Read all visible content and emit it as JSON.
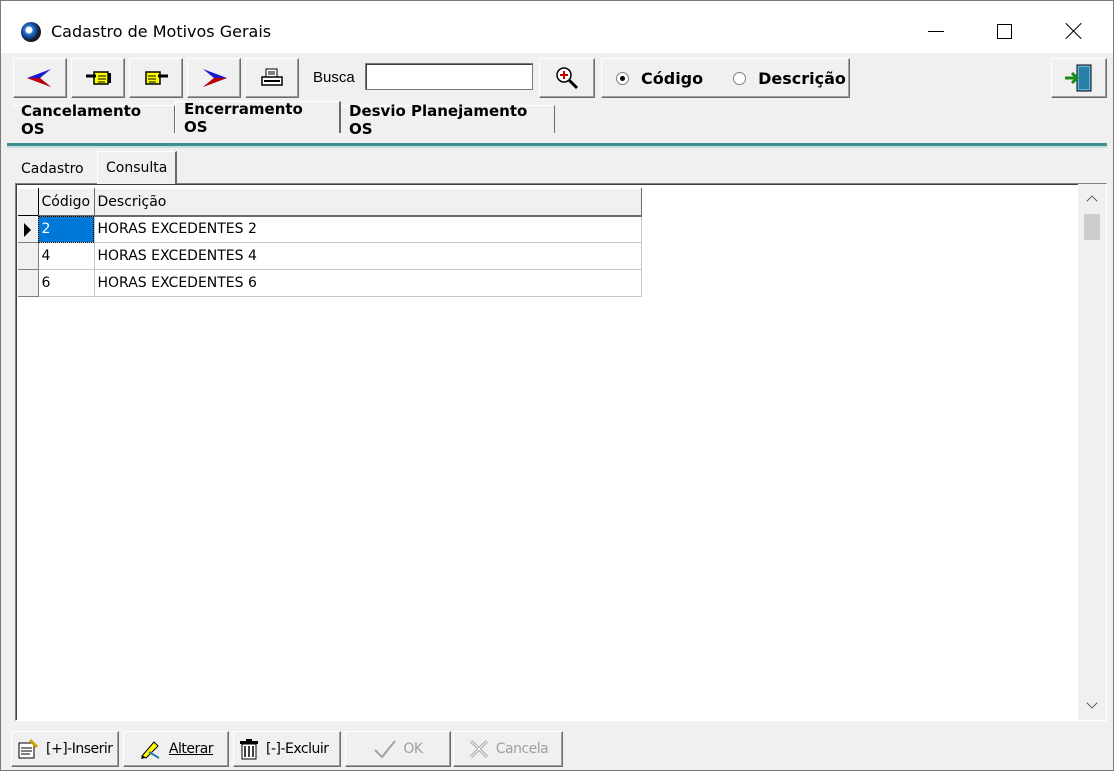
{
  "window": {
    "title": "Cadastro de Motivos Gerais",
    "icon": "app-globe-icon"
  },
  "toolbar": {
    "first": "arrow-left-blue-icon",
    "prev": "hand-left-icon",
    "next": "hand-right-icon",
    "last": "arrow-right-blue-icon",
    "print": "printer-icon",
    "busca_label": "Busca",
    "busca_value": "",
    "search": "magnifier-icon",
    "radio_codigo": "Código",
    "radio_descricao": "Descrição",
    "selected_radio": "Código",
    "exit": "exit-door-icon"
  },
  "tabs": [
    {
      "label": "Cancelamento OS",
      "active": false
    },
    {
      "label": "Encerramento OS",
      "active": true
    },
    {
      "label": "Desvio Planejamento OS",
      "active": false
    }
  ],
  "subtabs": [
    {
      "label": "Cadastro",
      "active": false
    },
    {
      "label": "Consulta",
      "active": true
    }
  ],
  "grid": {
    "columns": [
      "Código",
      "Descrição"
    ],
    "rows": [
      {
        "codigo": "2",
        "descricao": "HORAS EXCEDENTES 2",
        "selected": true
      },
      {
        "codigo": "4",
        "descricao": "HORAS EXCEDENTES 4",
        "selected": false
      },
      {
        "codigo": "6",
        "descricao": "HORAS EXCEDENTES 6",
        "selected": false
      }
    ]
  },
  "bottom": {
    "inserir": "[+]-Inserir",
    "alterar": "Alterar",
    "excluir": "[-]-Excluir",
    "ok": "OK",
    "cancela": "Cancela"
  },
  "colors": {
    "accent_teal": "#3c8d8e",
    "selection": "#0078d7",
    "nav_arrow": "#1a1ad0"
  }
}
